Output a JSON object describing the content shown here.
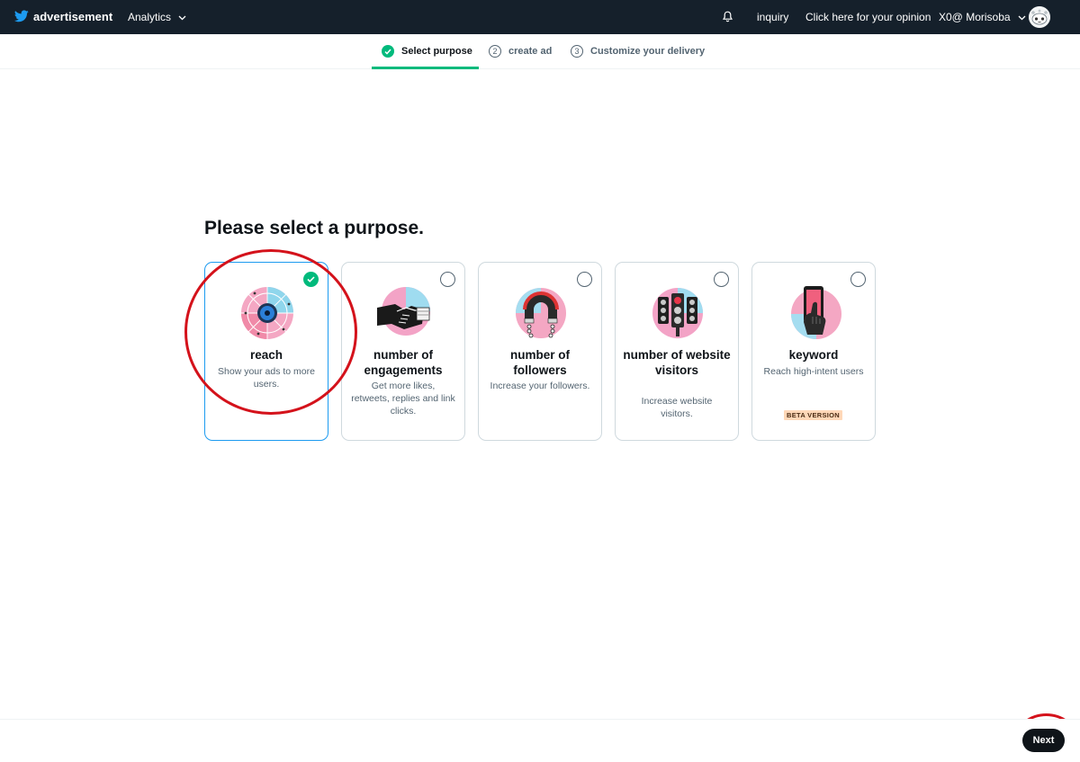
{
  "topbar": {
    "brand": "advertisement",
    "analytics_label": "Analytics",
    "inquiry_label": "inquiry",
    "opinion_label": "Click here for your opinion",
    "account_label": "X0@ Morisoba"
  },
  "stepper": {
    "steps": [
      {
        "number": "",
        "label": "Select purpose",
        "state": "done"
      },
      {
        "number": "2",
        "label": "create ad",
        "state": "pending"
      },
      {
        "number": "3",
        "label": "Customize your delivery",
        "state": "pending"
      }
    ]
  },
  "main": {
    "heading": "Please select a purpose.",
    "cards": [
      {
        "title": "reach",
        "description": "Show your ads to more users.",
        "selected": true,
        "icon": "radar-target-illustration"
      },
      {
        "title": "number of engagements",
        "description": "Get more likes, retweets, replies and link clicks.",
        "selected": false,
        "icon": "handshake-illustration"
      },
      {
        "title": "number of followers",
        "description": "Increase your followers.",
        "selected": false,
        "icon": "magnet-illustration"
      },
      {
        "title": "number of website visitors",
        "description": "Increase website visitors.",
        "selected": false,
        "icon": "traffic-light-illustration"
      },
      {
        "title": "keyword",
        "description": "Reach high-intent users",
        "selected": false,
        "badge": "BETA VERSION",
        "icon": "phone-hand-illustration"
      }
    ]
  },
  "footer": {
    "next_label": "Next"
  },
  "colors": {
    "topbar_bg": "#15202b",
    "accent_green": "#00ba7c",
    "selected_border": "#1d9bf0",
    "annotation_red": "#d4121b",
    "button_dark": "#0f1419"
  }
}
